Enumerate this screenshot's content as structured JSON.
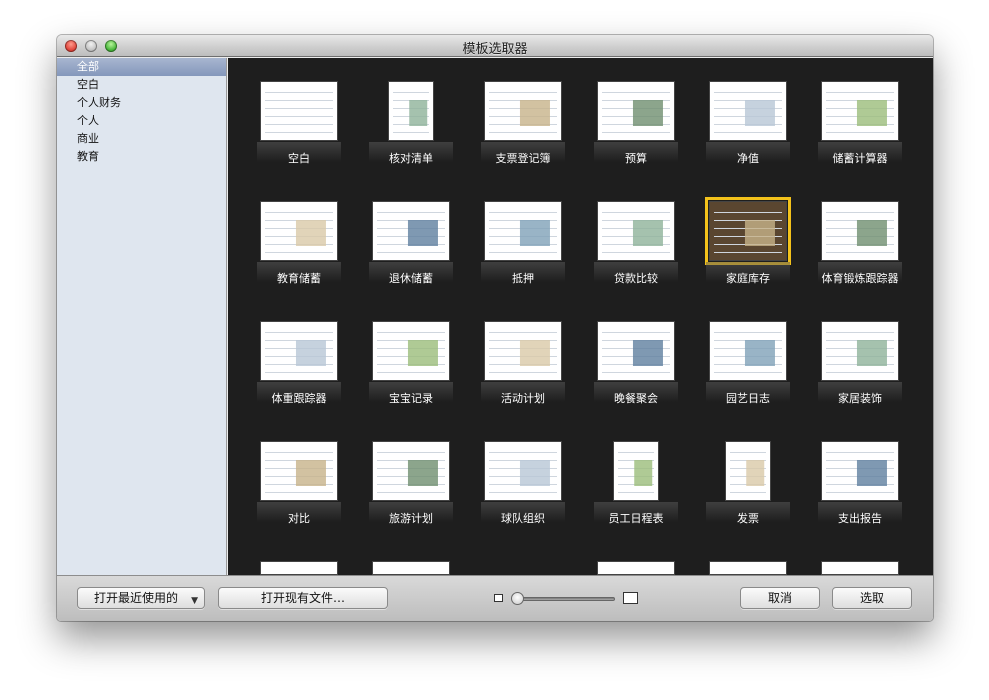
{
  "window": {
    "title": "模板选取器"
  },
  "sidebar": {
    "items": [
      {
        "label": "全部",
        "selected": true
      },
      {
        "label": "空白",
        "selected": false
      },
      {
        "label": "个人财务",
        "selected": false
      },
      {
        "label": "个人",
        "selected": false
      },
      {
        "label": "商业",
        "selected": false
      },
      {
        "label": "教育",
        "selected": false
      }
    ]
  },
  "templates": [
    {
      "label": "空白",
      "shape": "land"
    },
    {
      "label": "核对清单",
      "shape": "port"
    },
    {
      "label": "支票登记簿",
      "shape": "land"
    },
    {
      "label": "预算",
      "shape": "land"
    },
    {
      "label": "净值",
      "shape": "land"
    },
    {
      "label": "储蓄计算器",
      "shape": "land"
    },
    {
      "label": "教育储蓄",
      "shape": "land"
    },
    {
      "label": "退休储蓄",
      "shape": "land"
    },
    {
      "label": "抵押",
      "shape": "land"
    },
    {
      "label": "贷款比较",
      "shape": "land"
    },
    {
      "label": "家庭库存",
      "shape": "land",
      "selected": true
    },
    {
      "label": "体育锻炼跟踪器",
      "shape": "land"
    },
    {
      "label": "体重跟踪器",
      "shape": "land"
    },
    {
      "label": "宝宝记录",
      "shape": "land"
    },
    {
      "label": "活动计划",
      "shape": "land"
    },
    {
      "label": "晚餐聚会",
      "shape": "land"
    },
    {
      "label": "园艺日志",
      "shape": "land"
    },
    {
      "label": "家居装饰",
      "shape": "land"
    },
    {
      "label": "对比",
      "shape": "land"
    },
    {
      "label": "旅游计划",
      "shape": "land"
    },
    {
      "label": "球队组织",
      "shape": "land"
    },
    {
      "label": "员工日程表",
      "shape": "port"
    },
    {
      "label": "发票",
      "shape": "port"
    },
    {
      "label": "支出报告",
      "shape": "land"
    }
  ],
  "bottombar": {
    "open_recent": "打开最近使用的",
    "open_existing": "打开现有文件…",
    "cancel": "取消",
    "choose": "选取",
    "thumbnail_size": 0
  },
  "colors": {
    "selection_outline": "#f3c21b",
    "gallery_bg": "#1e1e1e",
    "sidebar_bg": "#dfe6ef"
  }
}
